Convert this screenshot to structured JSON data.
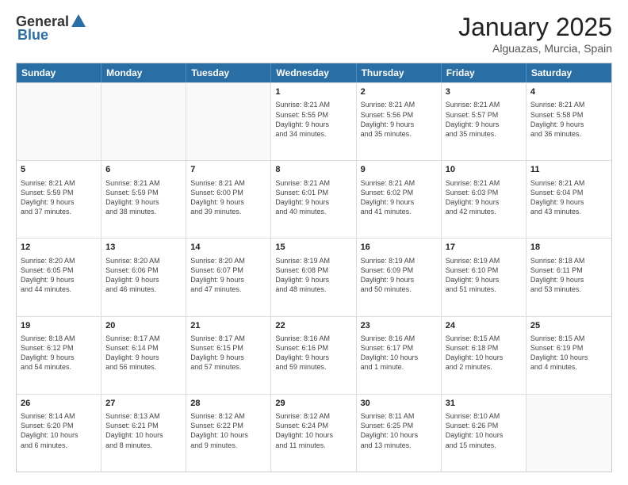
{
  "logo": {
    "general": "General",
    "blue": "Blue"
  },
  "title": "January 2025",
  "location": "Alguazas, Murcia, Spain",
  "days": [
    "Sunday",
    "Monday",
    "Tuesday",
    "Wednesday",
    "Thursday",
    "Friday",
    "Saturday"
  ],
  "weeks": [
    [
      {
        "day": "",
        "info": ""
      },
      {
        "day": "",
        "info": ""
      },
      {
        "day": "",
        "info": ""
      },
      {
        "day": "1",
        "info": "Sunrise: 8:21 AM\nSunset: 5:55 PM\nDaylight: 9 hours\nand 34 minutes."
      },
      {
        "day": "2",
        "info": "Sunrise: 8:21 AM\nSunset: 5:56 PM\nDaylight: 9 hours\nand 35 minutes."
      },
      {
        "day": "3",
        "info": "Sunrise: 8:21 AM\nSunset: 5:57 PM\nDaylight: 9 hours\nand 35 minutes."
      },
      {
        "day": "4",
        "info": "Sunrise: 8:21 AM\nSunset: 5:58 PM\nDaylight: 9 hours\nand 36 minutes."
      }
    ],
    [
      {
        "day": "5",
        "info": "Sunrise: 8:21 AM\nSunset: 5:59 PM\nDaylight: 9 hours\nand 37 minutes."
      },
      {
        "day": "6",
        "info": "Sunrise: 8:21 AM\nSunset: 5:59 PM\nDaylight: 9 hours\nand 38 minutes."
      },
      {
        "day": "7",
        "info": "Sunrise: 8:21 AM\nSunset: 6:00 PM\nDaylight: 9 hours\nand 39 minutes."
      },
      {
        "day": "8",
        "info": "Sunrise: 8:21 AM\nSunset: 6:01 PM\nDaylight: 9 hours\nand 40 minutes."
      },
      {
        "day": "9",
        "info": "Sunrise: 8:21 AM\nSunset: 6:02 PM\nDaylight: 9 hours\nand 41 minutes."
      },
      {
        "day": "10",
        "info": "Sunrise: 8:21 AM\nSunset: 6:03 PM\nDaylight: 9 hours\nand 42 minutes."
      },
      {
        "day": "11",
        "info": "Sunrise: 8:21 AM\nSunset: 6:04 PM\nDaylight: 9 hours\nand 43 minutes."
      }
    ],
    [
      {
        "day": "12",
        "info": "Sunrise: 8:20 AM\nSunset: 6:05 PM\nDaylight: 9 hours\nand 44 minutes."
      },
      {
        "day": "13",
        "info": "Sunrise: 8:20 AM\nSunset: 6:06 PM\nDaylight: 9 hours\nand 46 minutes."
      },
      {
        "day": "14",
        "info": "Sunrise: 8:20 AM\nSunset: 6:07 PM\nDaylight: 9 hours\nand 47 minutes."
      },
      {
        "day": "15",
        "info": "Sunrise: 8:19 AM\nSunset: 6:08 PM\nDaylight: 9 hours\nand 48 minutes."
      },
      {
        "day": "16",
        "info": "Sunrise: 8:19 AM\nSunset: 6:09 PM\nDaylight: 9 hours\nand 50 minutes."
      },
      {
        "day": "17",
        "info": "Sunrise: 8:19 AM\nSunset: 6:10 PM\nDaylight: 9 hours\nand 51 minutes."
      },
      {
        "day": "18",
        "info": "Sunrise: 8:18 AM\nSunset: 6:11 PM\nDaylight: 9 hours\nand 53 minutes."
      }
    ],
    [
      {
        "day": "19",
        "info": "Sunrise: 8:18 AM\nSunset: 6:12 PM\nDaylight: 9 hours\nand 54 minutes."
      },
      {
        "day": "20",
        "info": "Sunrise: 8:17 AM\nSunset: 6:14 PM\nDaylight: 9 hours\nand 56 minutes."
      },
      {
        "day": "21",
        "info": "Sunrise: 8:17 AM\nSunset: 6:15 PM\nDaylight: 9 hours\nand 57 minutes."
      },
      {
        "day": "22",
        "info": "Sunrise: 8:16 AM\nSunset: 6:16 PM\nDaylight: 9 hours\nand 59 minutes."
      },
      {
        "day": "23",
        "info": "Sunrise: 8:16 AM\nSunset: 6:17 PM\nDaylight: 10 hours\nand 1 minute."
      },
      {
        "day": "24",
        "info": "Sunrise: 8:15 AM\nSunset: 6:18 PM\nDaylight: 10 hours\nand 2 minutes."
      },
      {
        "day": "25",
        "info": "Sunrise: 8:15 AM\nSunset: 6:19 PM\nDaylight: 10 hours\nand 4 minutes."
      }
    ],
    [
      {
        "day": "26",
        "info": "Sunrise: 8:14 AM\nSunset: 6:20 PM\nDaylight: 10 hours\nand 6 minutes."
      },
      {
        "day": "27",
        "info": "Sunrise: 8:13 AM\nSunset: 6:21 PM\nDaylight: 10 hours\nand 8 minutes."
      },
      {
        "day": "28",
        "info": "Sunrise: 8:12 AM\nSunset: 6:22 PM\nDaylight: 10 hours\nand 9 minutes."
      },
      {
        "day": "29",
        "info": "Sunrise: 8:12 AM\nSunset: 6:24 PM\nDaylight: 10 hours\nand 11 minutes."
      },
      {
        "day": "30",
        "info": "Sunrise: 8:11 AM\nSunset: 6:25 PM\nDaylight: 10 hours\nand 13 minutes."
      },
      {
        "day": "31",
        "info": "Sunrise: 8:10 AM\nSunset: 6:26 PM\nDaylight: 10 hours\nand 15 minutes."
      },
      {
        "day": "",
        "info": ""
      }
    ]
  ]
}
